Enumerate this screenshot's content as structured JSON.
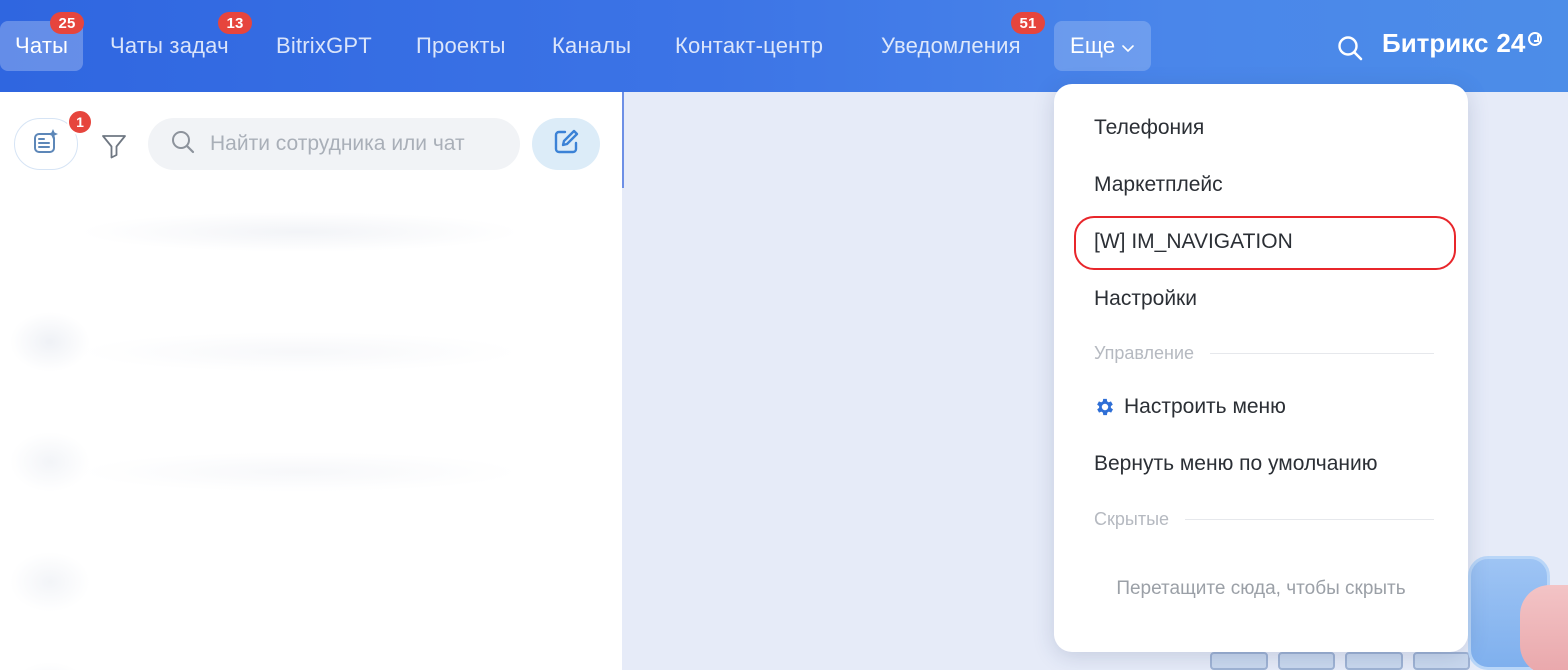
{
  "nav": {
    "tabs": [
      {
        "label": "Чаты",
        "badge": "25"
      },
      {
        "label": "Чаты задач",
        "badge": "13"
      },
      {
        "label": "BitrixGPT",
        "badge": ""
      },
      {
        "label": "Проекты",
        "badge": ""
      },
      {
        "label": "Каналы",
        "badge": ""
      },
      {
        "label": "Контакт-центр",
        "badge": ""
      },
      {
        "label": "Уведомления",
        "badge": "51"
      }
    ],
    "more_label": "Еще",
    "more_chevron": "⌄",
    "active_tab": "Чаты"
  },
  "brand": {
    "name": "Битрикс",
    "number": "24"
  },
  "left_panel": {
    "ai_badge": "1",
    "search_placeholder": "Найти сотрудника или чат"
  },
  "menu": {
    "items": [
      "Телефония",
      "Маркетплейс",
      "[W] IM_NAVIGATION",
      "Настройки"
    ],
    "section_manage": "Управление",
    "configure_label": "Настроить меню",
    "reset_label": "Вернуть меню по умолчанию",
    "section_hidden": "Скрытые",
    "hidden_hint": "Перетащите сюда, чтобы скрыть",
    "highlighted_item": "[W] IM_NAVIGATION"
  },
  "colors": {
    "accent": "#2f66e0",
    "badge": "#e6453d",
    "highlight_ring": "#e8262b",
    "gear": "#2f6fd6"
  },
  "icons": {
    "search": "search-icon",
    "filter": "filter-icon",
    "compose": "compose-icon",
    "ai": "ai-assistant-icon",
    "gear": "gear-icon",
    "chevron": "chevron-down-icon"
  }
}
